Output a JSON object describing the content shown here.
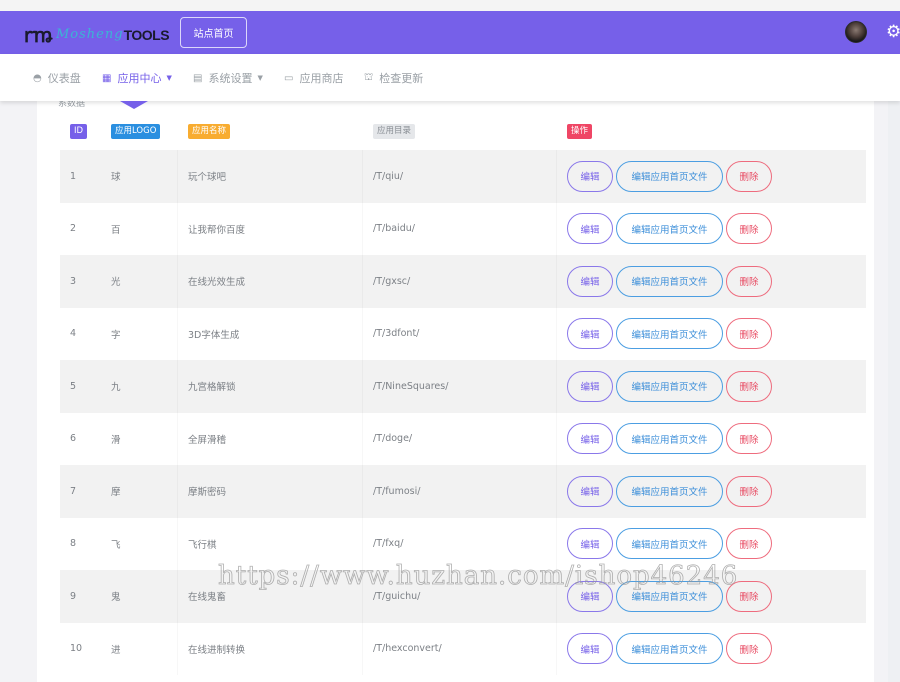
{
  "header": {
    "logo_mark": "ꭈꬺ",
    "logo_brand": "Mosheng",
    "logo_tools": "TOOLS",
    "site_home_label": "站点首页",
    "brand_color": "#7660e9"
  },
  "nav": {
    "items": [
      {
        "label": "仪表盘",
        "icon": "dashboard-icon",
        "glyph": "◓"
      },
      {
        "label": "应用中心",
        "icon": "grid-icon",
        "glyph": "▦",
        "active": true,
        "dropdown": true
      },
      {
        "label": "系统设置",
        "icon": "table-icon",
        "glyph": "▤",
        "dropdown": true
      },
      {
        "label": "应用商店",
        "icon": "laptop-icon",
        "glyph": "▭"
      },
      {
        "label": "检查更新",
        "icon": "update-icon",
        "glyph": "⛫"
      }
    ]
  },
  "page": {
    "subtitle": "系数据"
  },
  "table": {
    "headers": {
      "id": "ID",
      "logo": "应用LOGO",
      "name": "应用名称",
      "dir": "应用目录",
      "actions": "操作"
    },
    "header_colors": {
      "id": "#7660e9",
      "logo": "#2a8fe0",
      "name": "#f8ac30",
      "dir": "#e5e7ea",
      "actions": "#ef4665"
    },
    "action_labels": {
      "edit": "编辑",
      "edit_file": "编辑应用首页文件",
      "delete": "删除"
    },
    "rows": [
      {
        "id": "1",
        "logo": "球",
        "name": "玩个球吧",
        "dir": "/T/qiu/"
      },
      {
        "id": "2",
        "logo": "百",
        "name": "让我帮你百度",
        "dir": "/T/baidu/"
      },
      {
        "id": "3",
        "logo": "光",
        "name": "在线光效生成",
        "dir": "/T/gxsc/"
      },
      {
        "id": "4",
        "logo": "字",
        "name": "3D字体生成",
        "dir": "/T/3dfont/"
      },
      {
        "id": "5",
        "logo": "九",
        "name": "九宫格解锁",
        "dir": "/T/NineSquares/"
      },
      {
        "id": "6",
        "logo": "滑",
        "name": "全屏滑稽",
        "dir": "/T/doge/"
      },
      {
        "id": "7",
        "logo": "摩",
        "name": "摩斯密码",
        "dir": "/T/fumosi/"
      },
      {
        "id": "8",
        "logo": "飞",
        "name": "飞行棋",
        "dir": "/T/fxq/"
      },
      {
        "id": "9",
        "logo": "鬼",
        "name": "在线鬼畜",
        "dir": "/T/guichu/"
      },
      {
        "id": "10",
        "logo": "进",
        "name": "在线进制转换",
        "dir": "/T/hexconvert/"
      }
    ]
  },
  "watermark": "https://www.huzhan.com/ishop46246"
}
